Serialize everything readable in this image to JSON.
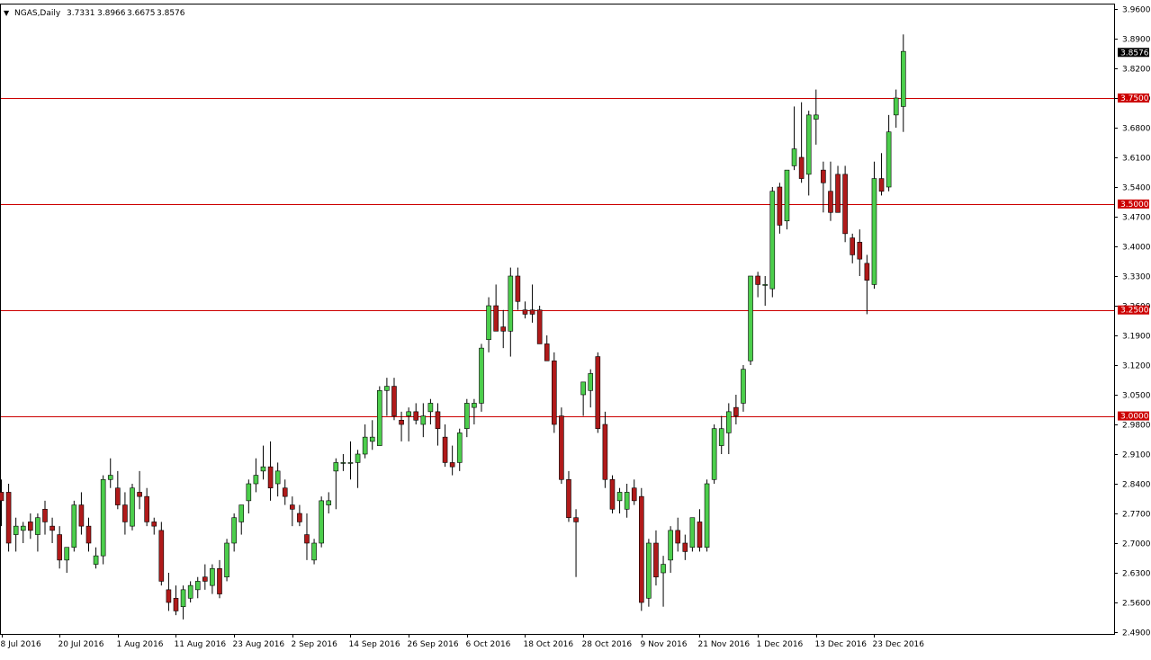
{
  "header": {
    "menu_arrow": "▼",
    "symbol": "NGAS,Daily",
    "ohlc": [
      "3.7331",
      "3.8966",
      "3.6675",
      "3.8576"
    ]
  },
  "colors": {
    "bull": "#4cce4c",
    "bear": "#b01a1a",
    "wick": "#000000",
    "level_line": "#cc0000",
    "current_price_bg": "#000000",
    "frame": "#000000"
  },
  "chart_data": {
    "type": "candlestick",
    "title": "NGAS,Daily",
    "ylim": [
      2.48,
      3.965
    ],
    "y_ticks": [
      "3.9600",
      "3.8900",
      "3.8200",
      "3.7500",
      "3.6800",
      "3.6100",
      "3.5400",
      "3.4700",
      "3.4000",
      "3.3300",
      "3.2600",
      "3.1900",
      "3.1200",
      "3.0500",
      "2.9800",
      "2.9100",
      "2.8400",
      "2.7700",
      "2.7000",
      "2.6300",
      "2.5600",
      "2.4900"
    ],
    "x_labels": [
      "8 Jul 2016",
      "20 Jul 2016",
      "1 Aug 2016",
      "11 Aug 2016",
      "23 Aug 2016",
      "2 Sep 2016",
      "14 Sep 2016",
      "26 Sep 2016",
      "6 Oct 2016",
      "18 Oct 2016",
      "28 Oct 2016",
      "9 Nov 2016",
      "21 Nov 2016",
      "1 Dec 2016",
      "13 Dec 2016",
      "23 Dec 2016"
    ],
    "x_label_bar_index": [
      0,
      8,
      16,
      24,
      32,
      40,
      48,
      56,
      64,
      72,
      80,
      88,
      96,
      104,
      112,
      120
    ],
    "horizontal_levels": [
      "3.0000",
      "3.2500",
      "3.5000",
      "3.7500"
    ],
    "current_price": "3.8576",
    "candles": [
      [
        2.82,
        2.85,
        2.74,
        2.8
      ],
      [
        2.82,
        2.84,
        2.68,
        2.7
      ],
      [
        2.72,
        2.76,
        2.68,
        2.74
      ],
      [
        2.73,
        2.75,
        2.7,
        2.74
      ],
      [
        2.75,
        2.77,
        2.71,
        2.73
      ],
      [
        2.72,
        2.77,
        2.68,
        2.76
      ],
      [
        2.78,
        2.8,
        2.72,
        2.75
      ],
      [
        2.74,
        2.76,
        2.7,
        2.73
      ],
      [
        2.72,
        2.74,
        2.64,
        2.66
      ],
      [
        2.66,
        2.69,
        2.63,
        2.69
      ],
      [
        2.69,
        2.8,
        2.68,
        2.79
      ],
      [
        2.79,
        2.82,
        2.72,
        2.74
      ],
      [
        2.74,
        2.76,
        2.68,
        2.7
      ],
      [
        2.65,
        2.69,
        2.64,
        2.67
      ],
      [
        2.67,
        2.86,
        2.65,
        2.85
      ],
      [
        2.85,
        2.9,
        2.83,
        2.86
      ],
      [
        2.83,
        2.87,
        2.78,
        2.79
      ],
      [
        2.79,
        2.82,
        2.72,
        2.75
      ],
      [
        2.74,
        2.84,
        2.73,
        2.83
      ],
      [
        2.82,
        2.87,
        2.78,
        2.81
      ],
      [
        2.81,
        2.83,
        2.74,
        2.75
      ],
      [
        2.75,
        2.76,
        2.72,
        2.74
      ],
      [
        2.73,
        2.75,
        2.6,
        2.61
      ],
      [
        2.59,
        2.63,
        2.54,
        2.56
      ],
      [
        2.57,
        2.6,
        2.53,
        2.54
      ],
      [
        2.55,
        2.6,
        2.52,
        2.59
      ],
      [
        2.57,
        2.61,
        2.56,
        2.6
      ],
      [
        2.59,
        2.62,
        2.57,
        2.61
      ],
      [
        2.62,
        2.65,
        2.59,
        2.61
      ],
      [
        2.6,
        2.65,
        2.58,
        2.64
      ],
      [
        2.64,
        2.66,
        2.57,
        2.58
      ],
      [
        2.62,
        2.71,
        2.61,
        2.7
      ],
      [
        2.7,
        2.77,
        2.68,
        2.76
      ],
      [
        2.75,
        2.79,
        2.72,
        2.79
      ],
      [
        2.8,
        2.85,
        2.77,
        2.84
      ],
      [
        2.84,
        2.9,
        2.82,
        2.86
      ],
      [
        2.87,
        2.93,
        2.85,
        2.88
      ],
      [
        2.88,
        2.94,
        2.8,
        2.83
      ],
      [
        2.84,
        2.89,
        2.81,
        2.87
      ],
      [
        2.83,
        2.85,
        2.79,
        2.81
      ],
      [
        2.79,
        2.81,
        2.74,
        2.78
      ],
      [
        2.77,
        2.79,
        2.74,
        2.75
      ],
      [
        2.72,
        2.77,
        2.66,
        2.7
      ],
      [
        2.66,
        2.71,
        2.65,
        2.7
      ],
      [
        2.7,
        2.81,
        2.69,
        2.8
      ],
      [
        2.79,
        2.82,
        2.77,
        2.8
      ],
      [
        2.87,
        2.9,
        2.78,
        2.89
      ],
      [
        2.89,
        2.91,
        2.87,
        2.89
      ],
      [
        2.89,
        2.94,
        2.85,
        2.89
      ],
      [
        2.89,
        2.92,
        2.83,
        2.91
      ],
      [
        2.91,
        2.98,
        2.9,
        2.95
      ],
      [
        2.94,
        2.99,
        2.92,
        2.95
      ],
      [
        2.93,
        3.07,
        2.93,
        3.06
      ],
      [
        3.06,
        3.09,
        3.0,
        3.07
      ],
      [
        3.07,
        3.09,
        2.99,
        3.0
      ],
      [
        2.99,
        3.01,
        2.94,
        2.98
      ],
      [
        3.0,
        3.02,
        2.94,
        3.01
      ],
      [
        3.01,
        3.03,
        2.98,
        2.99
      ],
      [
        2.98,
        3.03,
        2.95,
        3.0
      ],
      [
        3.01,
        3.04,
        2.98,
        3.03
      ],
      [
        3.01,
        3.03,
        2.93,
        2.97
      ],
      [
        2.95,
        2.98,
        2.88,
        2.89
      ],
      [
        2.89,
        2.93,
        2.86,
        2.88
      ],
      [
        2.89,
        2.97,
        2.87,
        2.96
      ],
      [
        2.97,
        3.04,
        2.95,
        3.03
      ],
      [
        3.02,
        3.04,
        2.98,
        3.03
      ],
      [
        3.03,
        3.17,
        3.01,
        3.16
      ],
      [
        3.18,
        3.28,
        3.15,
        3.26
      ],
      [
        3.26,
        3.31,
        3.21,
        3.2
      ],
      [
        3.21,
        3.25,
        3.16,
        3.2
      ],
      [
        3.2,
        3.35,
        3.14,
        3.33
      ],
      [
        3.33,
        3.35,
        3.25,
        3.27
      ],
      [
        3.25,
        3.27,
        3.23,
        3.24
      ],
      [
        3.25,
        3.31,
        3.22,
        3.24
      ],
      [
        3.25,
        3.26,
        3.17,
        3.17
      ],
      [
        3.17,
        3.19,
        3.13,
        3.13
      ],
      [
        3.13,
        3.15,
        2.96,
        2.98
      ],
      [
        3.0,
        3.02,
        2.84,
        2.85
      ],
      [
        2.85,
        2.87,
        2.75,
        2.76
      ],
      [
        2.76,
        2.78,
        2.62,
        2.75
      ],
      [
        3.05,
        3.07,
        3.0,
        3.08
      ],
      [
        3.06,
        3.11,
        3.02,
        3.1
      ],
      [
        3.14,
        3.15,
        2.96,
        2.97
      ],
      [
        2.98,
        3.01,
        2.83,
        2.85
      ],
      [
        2.85,
        2.86,
        2.77,
        2.78
      ],
      [
        2.8,
        2.83,
        2.77,
        2.82
      ],
      [
        2.78,
        2.84,
        2.76,
        2.82
      ],
      [
        2.83,
        2.85,
        2.79,
        2.8
      ],
      [
        2.81,
        2.83,
        2.54,
        2.56
      ],
      [
        2.57,
        2.71,
        2.55,
        2.7
      ],
      [
        2.7,
        2.73,
        2.6,
        2.62
      ],
      [
        2.63,
        2.67,
        2.55,
        2.65
      ],
      [
        2.66,
        2.74,
        2.63,
        2.73
      ],
      [
        2.73,
        2.76,
        2.68,
        2.7
      ],
      [
        2.7,
        2.72,
        2.66,
        2.68
      ],
      [
        2.69,
        2.76,
        2.68,
        2.76
      ],
      [
        2.75,
        2.78,
        2.68,
        2.69
      ],
      [
        2.69,
        2.85,
        2.68,
        2.84
      ],
      [
        2.85,
        2.98,
        2.84,
        2.97
      ],
      [
        2.93,
        3.0,
        2.91,
        2.97
      ],
      [
        2.96,
        3.03,
        2.91,
        3.01
      ],
      [
        3.02,
        3.05,
        2.98,
        3.0
      ],
      [
        3.03,
        3.12,
        3.01,
        3.11
      ],
      [
        3.13,
        3.33,
        3.12,
        3.33
      ],
      [
        3.33,
        3.34,
        3.28,
        3.31
      ],
      [
        3.31,
        3.33,
        3.26,
        3.31
      ],
      [
        3.3,
        3.54,
        3.28,
        3.53
      ],
      [
        3.54,
        3.55,
        3.43,
        3.45
      ],
      [
        3.46,
        3.58,
        3.44,
        3.58
      ],
      [
        3.59,
        3.73,
        3.58,
        3.63
      ],
      [
        3.61,
        3.74,
        3.55,
        3.56
      ],
      [
        3.57,
        3.72,
        3.52,
        3.71
      ],
      [
        3.7,
        3.77,
        3.64,
        3.71
      ],
      [
        3.58,
        3.6,
        3.48,
        3.55
      ],
      [
        3.53,
        3.6,
        3.46,
        3.48
      ],
      [
        3.57,
        3.59,
        3.48,
        3.48
      ],
      [
        3.57,
        3.59,
        3.41,
        3.43
      ],
      [
        3.42,
        3.43,
        3.36,
        3.38
      ],
      [
        3.41,
        3.44,
        3.33,
        3.37
      ],
      [
        3.36,
        3.38,
        3.24,
        3.32
      ],
      [
        3.31,
        3.6,
        3.3,
        3.56
      ],
      [
        3.56,
        3.62,
        3.52,
        3.53
      ],
      [
        3.54,
        3.71,
        3.53,
        3.67
      ],
      [
        3.71,
        3.77,
        3.68,
        3.75
      ],
      [
        3.73,
        3.9,
        3.67,
        3.86
      ]
    ]
  }
}
